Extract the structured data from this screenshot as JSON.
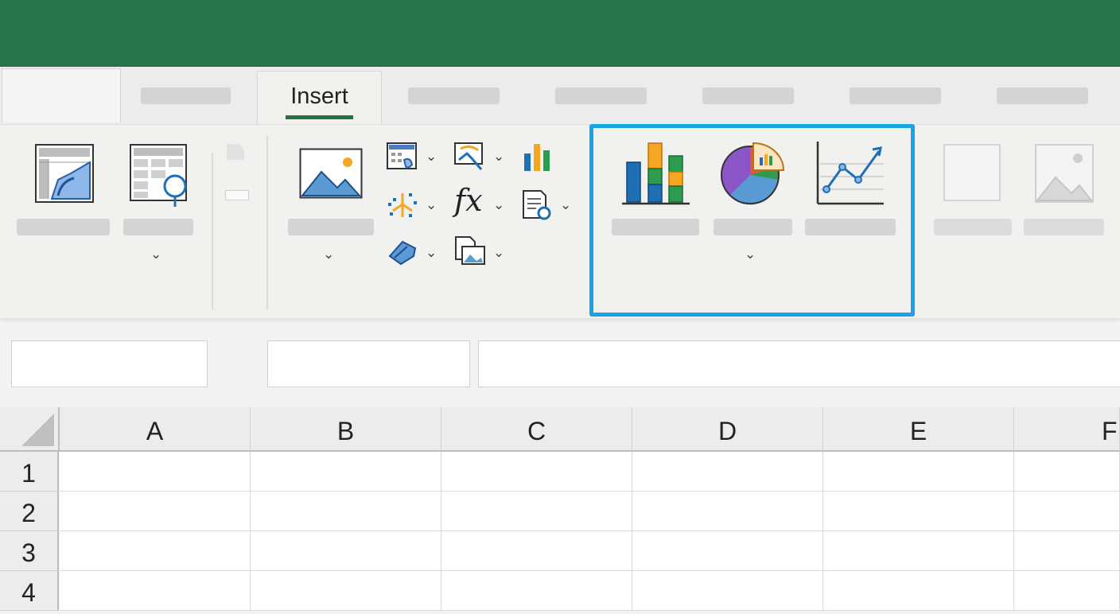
{
  "ribbon": {
    "active_tab": "Insert",
    "chart_group_highlight_color": "#18a3e5",
    "brand_color": "#25744a",
    "icons": [
      "pivottable-icon",
      "recommended-pivottable-icon",
      "pictures-icon",
      "table-icon",
      "shapes-icon",
      "smartart-icon",
      "chart-small-icon",
      "fx-icon",
      "form-icon",
      "link-icon",
      "screenshot-icon",
      "column-chart-icon",
      "pie-chart-icon",
      "line-chart-icon",
      "blank-shape-icon",
      "image-placeholder-icon"
    ]
  },
  "sheet": {
    "columns": [
      "A",
      "B",
      "C",
      "D",
      "E",
      "F"
    ],
    "rows": [
      "1",
      "2",
      "3",
      "4"
    ]
  }
}
